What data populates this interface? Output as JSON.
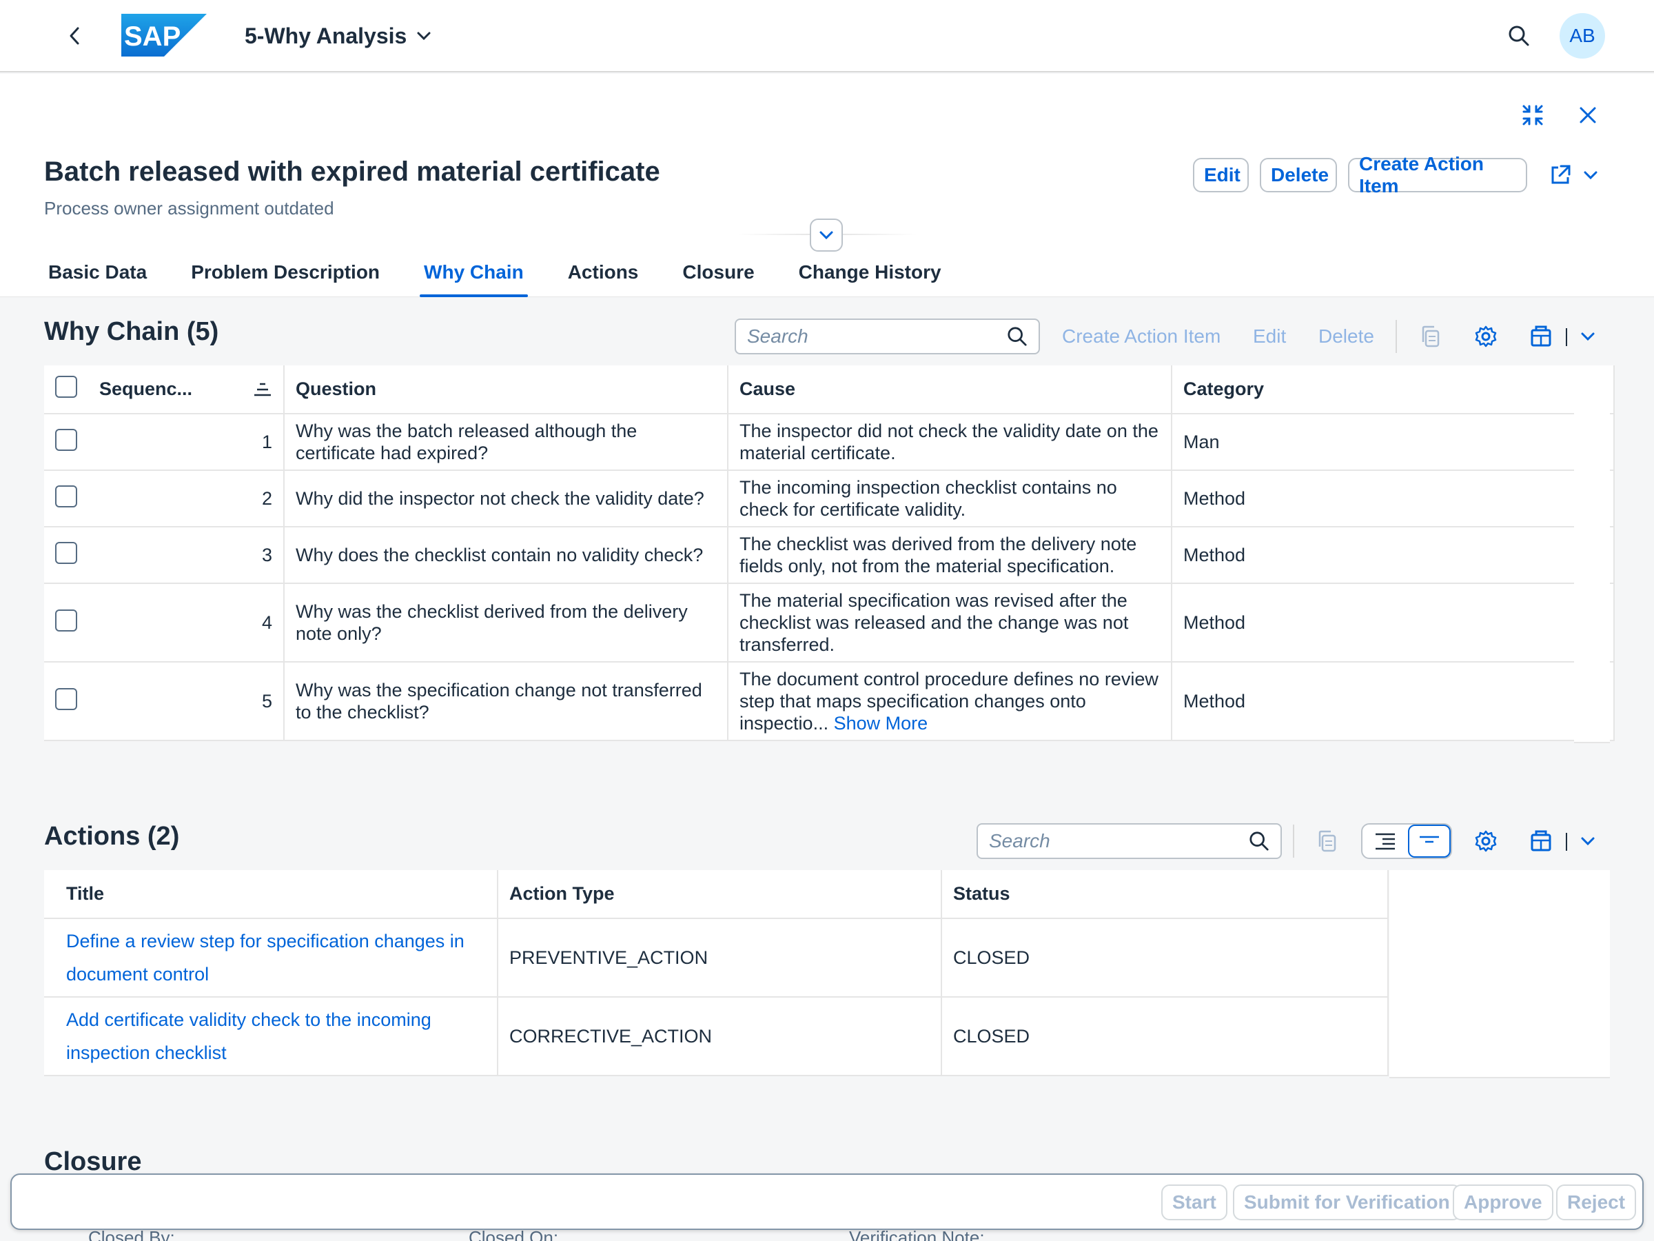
{
  "shell": {
    "app_title": "5-Why Analysis",
    "avatar_initials": "AB"
  },
  "header": {
    "title": "Batch released with expired material certificate",
    "subtitle": "Process owner assignment outdated",
    "edit_label": "Edit",
    "delete_label": "Delete",
    "create_action_label": "Create Action Item"
  },
  "tabs": [
    "Basic Data",
    "Problem Description",
    "Why Chain",
    "Actions",
    "Closure",
    "Change History"
  ],
  "why_chain": {
    "title": "Why Chain (5)",
    "search_placeholder": "Search",
    "create_action_label": "Create Action Item",
    "edit_label": "Edit",
    "delete_label": "Delete",
    "columns": [
      "Sequenc...",
      "Question",
      "Cause",
      "Category"
    ],
    "rows": [
      {
        "seq": "1",
        "question": "Why was the batch released although the certificate had expired?",
        "cause": "The inspector did not check the validity date on the material certificate.",
        "category": "Man"
      },
      {
        "seq": "2",
        "question": "Why did the inspector not check the validity date?",
        "cause": "The incoming inspection checklist contains no check for certificate validity.",
        "category": "Method"
      },
      {
        "seq": "3",
        "question": "Why does the checklist contain no validity check?",
        "cause": "The checklist was derived from the delivery note fields only, not from the material specification.",
        "category": "Method"
      },
      {
        "seq": "4",
        "question": "Why was the checklist derived from the delivery note only?",
        "cause": "The material specification was revised after the checklist was released and the change was not transferred.",
        "category": "Method"
      },
      {
        "seq": "5",
        "question": "Why was the specification change not transferred to the checklist?",
        "cause": "The document control procedure defines no review step that maps specification changes onto inspectio...",
        "category": "Method"
      }
    ],
    "show_more_label": "Show More"
  },
  "actions": {
    "title": "Actions (2)",
    "search_placeholder": "Search",
    "columns": [
      "Title",
      "Action Type",
      "Status"
    ],
    "rows": [
      {
        "title": "Define a review step for specification changes in document control",
        "type": "PREVENTIVE_ACTION",
        "status": "CLOSED"
      },
      {
        "title": "Add certificate validity check to the incoming inspection checklist",
        "type": "CORRECTIVE_ACTION",
        "status": "CLOSED"
      }
    ]
  },
  "closure": {
    "title": "Closure",
    "fields": [
      "Closed By:",
      "Closed On:",
      "Verification Note:"
    ]
  },
  "footer": {
    "start_label": "Start",
    "submit_label": "Submit for Verification",
    "approve_label": "Approve",
    "reject_label": "Reject"
  },
  "colors": {
    "brand": "#0064d9",
    "text": "#1d2d3e",
    "muted": "#556b82",
    "disabled": "#a9bcd3"
  },
  "icons": [
    "back-icon",
    "sap-logo",
    "chevron-down-icon",
    "search-icon",
    "exit-fullscreen-icon",
    "close-icon",
    "share-icon",
    "copy-icon",
    "settings-icon",
    "export-icon",
    "expand-rows-icon",
    "collapse-rows-icon",
    "sort-icon"
  ]
}
